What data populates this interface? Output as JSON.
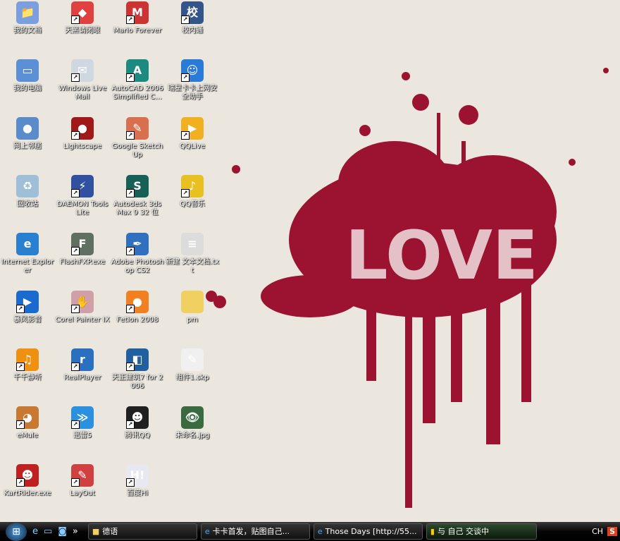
{
  "desktop": {
    "icons": [
      {
        "label": "我的文档",
        "icon": "my-documents",
        "color": "#7a9ee0",
        "g": "📁",
        "sc": false
      },
      {
        "label": "天黑请闭眼",
        "icon": "game-cube",
        "color": "#e04040",
        "g": "◆",
        "sc": true
      },
      {
        "label": "Mario Forever",
        "icon": "mario",
        "color": "#c33",
        "g": "M",
        "sc": true
      },
      {
        "label": "校内通",
        "icon": "xiaonei",
        "color": "#33558a",
        "g": "校",
        "sc": true
      },
      {
        "label": "我的电脑",
        "icon": "my-computer",
        "color": "#5b8fd6",
        "g": "▭",
        "sc": false
      },
      {
        "label": "Windows Live Mail",
        "icon": "mail",
        "color": "#cfd8e0",
        "g": "✉",
        "sc": true
      },
      {
        "label": "AutoCAD 2006 Simplified C...",
        "icon": "autocad",
        "color": "#1b8a80",
        "g": "A",
        "sc": true
      },
      {
        "label": "瑞星卡卡上网安全助手",
        "icon": "rising",
        "color": "#2a7ad8",
        "g": "☺",
        "sc": true
      },
      {
        "label": "网上邻居",
        "icon": "network",
        "color": "#5a8ccc",
        "g": "●",
        "sc": false
      },
      {
        "label": "Lightscape",
        "icon": "lightscape",
        "color": "#a01818",
        "g": "●",
        "sc": true
      },
      {
        "label": "Google SketchUp",
        "icon": "sketchup",
        "color": "#d87050",
        "g": "✎",
        "sc": true
      },
      {
        "label": "QQLive",
        "icon": "qqlive",
        "color": "#f0b020",
        "g": "▶",
        "sc": true
      },
      {
        "label": "回收站",
        "icon": "recycle-bin",
        "color": "#9fbfd8",
        "g": "♻",
        "sc": false
      },
      {
        "label": "DAEMON Tools Lite",
        "icon": "daemon-tools",
        "color": "#3050a0",
        "g": "⚡",
        "sc": true
      },
      {
        "label": "Autodesk 3ds Max 9 32 位",
        "icon": "3dsmax",
        "color": "#176058",
        "g": "S",
        "sc": true
      },
      {
        "label": "QQ音乐",
        "icon": "qq-music",
        "color": "#e8c020",
        "g": "♪",
        "sc": true
      },
      {
        "label": "Internet Explorer",
        "icon": "ie",
        "color": "#2a80d0",
        "g": "e",
        "sc": false
      },
      {
        "label": "FlashFXP.exe",
        "icon": "flashfxp",
        "color": "#607060",
        "g": "F",
        "sc": true
      },
      {
        "label": "Adobe Photoshop CS2",
        "icon": "photoshop",
        "color": "#3070c0",
        "g": "✒",
        "sc": true
      },
      {
        "label": "新建 文本文档.txt",
        "icon": "text-file",
        "color": "#dcdcdc",
        "g": "≡",
        "sc": false
      },
      {
        "label": "暴风影音",
        "icon": "baofeng",
        "color": "#1a6ad0",
        "g": "▶",
        "sc": true
      },
      {
        "label": "Corel Painter IX",
        "icon": "painter",
        "color": "#d0a0a8",
        "g": "✋",
        "sc": true
      },
      {
        "label": "Fetion 2008",
        "icon": "fetion",
        "color": "#f08020",
        "g": "●",
        "sc": true
      },
      {
        "label": "pm",
        "icon": "folder",
        "color": "#f0d060",
        "g": "",
        "sc": false
      },
      {
        "label": "千千静听",
        "icon": "ttplayer",
        "color": "#f09010",
        "g": "♫",
        "sc": true
      },
      {
        "label": "RealPlayer",
        "icon": "realplayer",
        "color": "#2a70c0",
        "g": "r",
        "sc": true
      },
      {
        "label": "天正建筑7 for 2006",
        "icon": "tangent",
        "color": "#2060a0",
        "g": "◧",
        "sc": true
      },
      {
        "label": "组件1.skp",
        "icon": "skp-file",
        "color": "#f0f0f0",
        "g": "✎",
        "sc": false
      },
      {
        "label": "eMule",
        "icon": "emule",
        "color": "#c87830",
        "g": "◕",
        "sc": true
      },
      {
        "label": "迅雷5",
        "icon": "thunder",
        "color": "#2a90e0",
        "g": "≫",
        "sc": true
      },
      {
        "label": "腾讯QQ",
        "icon": "qq",
        "color": "#202020",
        "g": "☻",
        "sc": true
      },
      {
        "label": "未命名.jpg",
        "icon": "jpg-file",
        "color": "#3a6a40",
        "g": "👁",
        "sc": false
      },
      {
        "label": "KartRider.exe",
        "icon": "kartrider",
        "color": "#c02020",
        "g": "☻",
        "sc": true
      },
      {
        "label": "LayOut",
        "icon": "layout",
        "color": "#d04040",
        "g": "✎",
        "sc": true
      },
      {
        "label": "百度Hi",
        "icon": "baidu-hi",
        "color": "#e8e8f0",
        "g": "H!",
        "sc": true
      }
    ]
  },
  "wallpaper": {
    "text": "LOVE",
    "accent": "#9b1330"
  },
  "taskbar": {
    "quicklaunch_more": "»",
    "tasks": [
      {
        "label": "德语",
        "icon": "folder-icon"
      },
      {
        "label": "卡卡首发，贴图自己...",
        "icon": "ie-icon"
      },
      {
        "label": "Those Days [http://55...",
        "icon": "ie-icon"
      },
      {
        "label": "与 自己 交谈中",
        "icon": "chat-icon"
      }
    ],
    "lang": "CH",
    "tray_icon": "S"
  }
}
